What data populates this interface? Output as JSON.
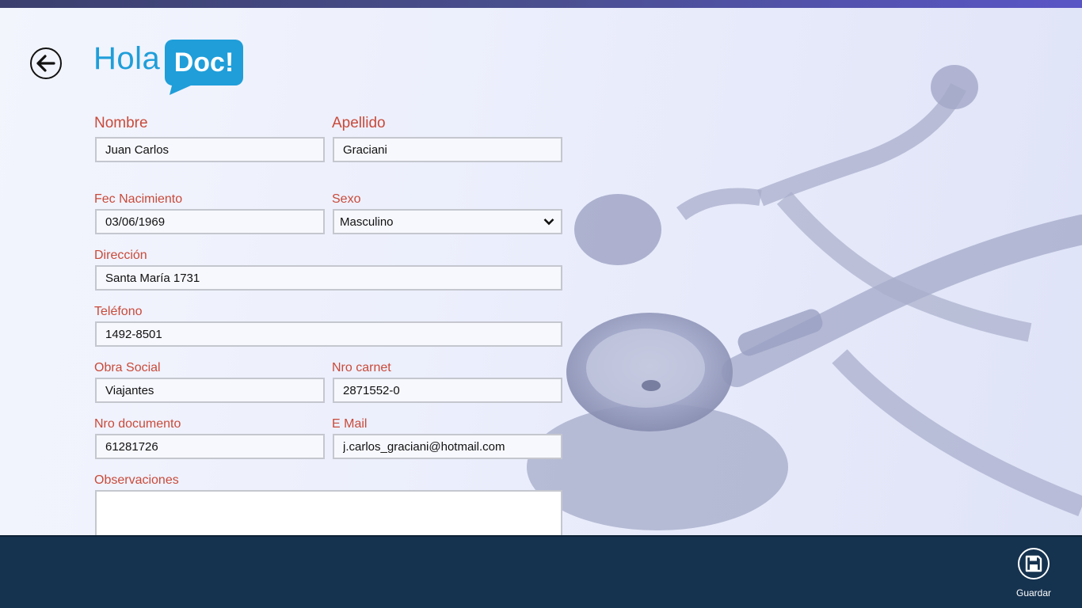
{
  "app": {
    "logo_text": "Hola",
    "logo_bubble": "Doc!"
  },
  "form": {
    "nombre_label": "Nombre",
    "nombre_value": "Juan Carlos",
    "apellido_label": "Apellido",
    "apellido_value": "Graciani",
    "fec_nacimiento_label": "Fec Nacimiento",
    "fec_nacimiento_value": "03/06/1969",
    "sexo_label": "Sexo",
    "sexo_value": "Masculino",
    "direccion_label": "Dirección",
    "direccion_value": "Santa María 1731",
    "telefono_label": "Teléfono",
    "telefono_value": "1492-8501",
    "obra_social_label": "Obra Social",
    "obra_social_value": "Viajantes",
    "nro_carnet_label": "Nro carnet",
    "nro_carnet_value": "2871552-0",
    "nro_documento_label": "Nro documento",
    "nro_documento_value": "61281726",
    "email_label": "E Mail",
    "email_value": "j.carlos_graciani@hotmail.com",
    "observaciones_label": "Observaciones",
    "observaciones_value": ""
  },
  "appbar": {
    "save_label": "Guardar"
  },
  "icons": {
    "back": "back-arrow-icon",
    "save": "floppy-disk-icon",
    "dropdown": "chevron-down-icon"
  },
  "colors": {
    "label": "#c94a3a",
    "brand": "#1f9ed9",
    "appbar": "#15324f"
  }
}
